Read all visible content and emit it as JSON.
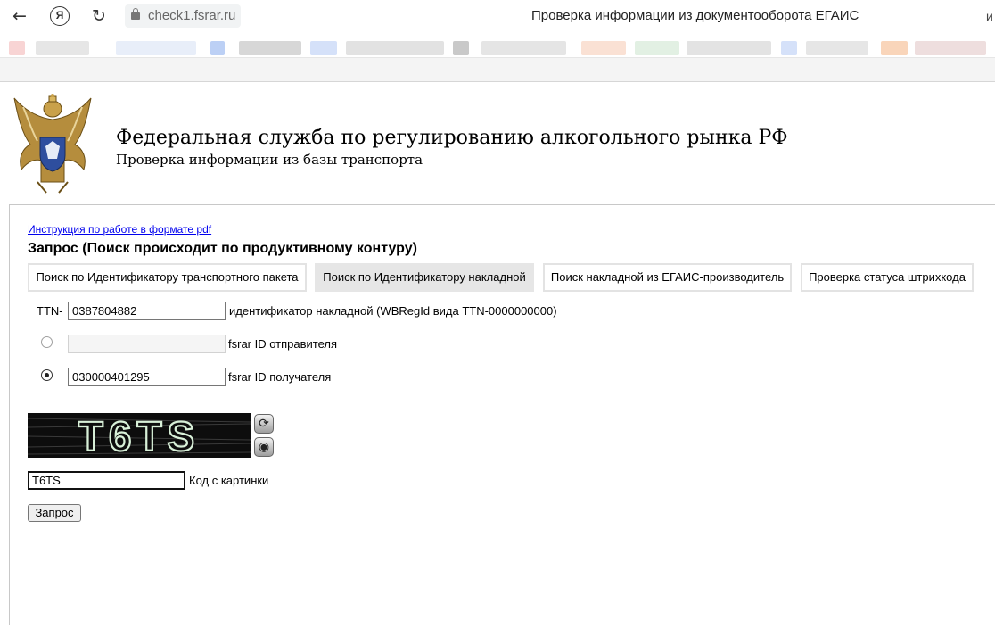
{
  "browser": {
    "url": "check1.fsrar.ru",
    "tab_title": "Проверка информации из документооборота ЕГАИС",
    "overflow_glyph": "и",
    "back_icon": "←",
    "refresh_icon": "↻",
    "yandex_icon": "Я"
  },
  "header": {
    "title": "Федеральная служба по регулированию алкогольного рынка РФ",
    "subtitle": "Проверка информации из базы транспорта"
  },
  "main": {
    "pdf_link": "Инструкция по работе в формате pdf",
    "heading": "Запрос (Поиск происходит по продуктивному контуру)",
    "tabs": [
      {
        "label": "Поиск по Идентификатору транспортного пакета",
        "active": false
      },
      {
        "label": "Поиск по Идентификатору накладной",
        "active": true
      },
      {
        "label": "Поиск накладной из ЕГАИС-производитель",
        "active": false
      },
      {
        "label": "Проверка статуса штрихкода",
        "active": false
      }
    ],
    "form": {
      "ttn_prefix": "TTN-",
      "ttn_value": "0387804882",
      "ttn_hint": "идентификатор накладной (WBRegId вида TTN-0000000000)",
      "sender_value": "",
      "sender_label": "fsrar ID отправителя",
      "receiver_value": "030000401295",
      "receiver_label": "fsrar ID получателя",
      "selected_option": "receiver"
    },
    "captcha": {
      "image_text": "T6TS",
      "refresh_icon": "⟳",
      "audio_icon": "◉",
      "input_value": "T6TS",
      "input_label": "Код с картинки"
    },
    "submit_label": "Запрос"
  }
}
